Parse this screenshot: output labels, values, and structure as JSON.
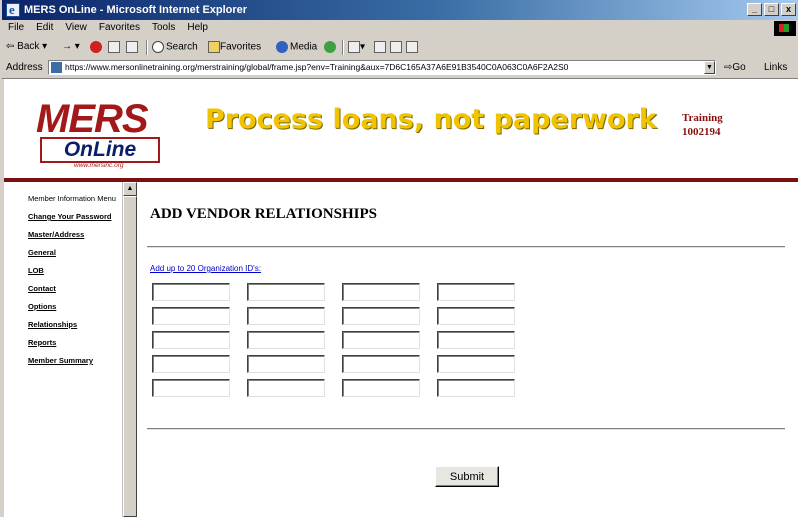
{
  "window": {
    "title": "MERS OnLine - Microsoft Internet Explorer",
    "buttons": {
      "minimize": "_",
      "restore": "□",
      "close": "x"
    }
  },
  "menu": [
    "File",
    "Edit",
    "View",
    "Favorites",
    "Tools",
    "Help"
  ],
  "toolbar": {
    "back": "Back",
    "search": "Search",
    "favorites": "Favorites",
    "media": "Media"
  },
  "address": {
    "label": "Address",
    "url": "https://www.mersonlinetraining.org/merstraining/global/frame.jsp?env=Training&aux=7D6C165A37A6E91B3540C0A063C0A6F2A2S0",
    "go": "Go",
    "links": "Links"
  },
  "banner": {
    "logo_mers": "MERS",
    "logo_online": "OnLine",
    "logo_www": "www.mersinc.org",
    "slogan": "Process loans, not paperwork",
    "env_label": "Training",
    "org_id": "1002194"
  },
  "sidebar": {
    "items": [
      {
        "label": "Member Information Menu",
        "link": false
      },
      {
        "label": "Change Your Password",
        "link": true
      },
      {
        "label": "Master/Address",
        "link": true
      },
      {
        "label": "General",
        "link": true
      },
      {
        "label": "LOB",
        "link": true
      },
      {
        "label": "Contact",
        "link": true
      },
      {
        "label": "Options",
        "link": true
      },
      {
        "label": "Relationships",
        "link": true
      },
      {
        "label": "Reports",
        "link": true
      },
      {
        "label": "Member Summary",
        "link": true
      }
    ]
  },
  "main": {
    "heading": "ADD VENDOR RELATIONSHIPS",
    "add_link": "Add up to 20 Organization ID's:",
    "org_id_fields": [
      "",
      "",
      "",
      "",
      "",
      "",
      "",
      "",
      "",
      "",
      "",
      "",
      "",
      "",
      "",
      "",
      "",
      "",
      "",
      ""
    ],
    "submit_label": "Submit"
  },
  "colors": {
    "brand_red": "#a31818",
    "banner_rule": "#7b1010",
    "slogan_yellow": "#f0c400",
    "link_blue": "#0000cc",
    "titlebar_blue": "#0a246a"
  }
}
